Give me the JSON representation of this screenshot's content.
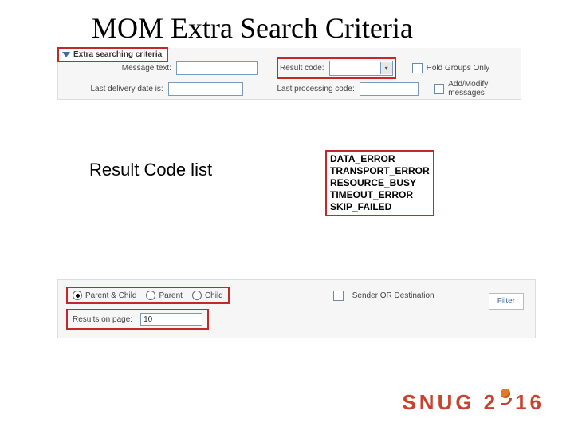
{
  "title": "MOM Extra Search Criteria",
  "panel": {
    "header": "Extra searching criteria",
    "message_text_label": "Message text:",
    "result_code_label": "Result code:",
    "hold_groups_label": "Hold Groups Only",
    "last_delivery_label": "Last delivery date is:",
    "last_processing_label": "Last processing code:",
    "add_modify_label": "Add/Modify messages"
  },
  "callout": {
    "label": "Result Code list",
    "items": [
      "DATA_ERROR",
      "TRANSPORT_ERROR",
      "RESOURCE_BUSY",
      "TIMEOUT_ERROR",
      "SKIP_FAILED"
    ]
  },
  "bottom": {
    "radios": {
      "parent_child": "Parent & Child",
      "parent": "Parent",
      "child": "Child"
    },
    "sender_or_dest": "Sender OR Destination",
    "results_on_page_label": "Results on page:",
    "results_on_page_value": "10",
    "filter_label": "Filter"
  },
  "logo": {
    "s": "S",
    "n": "N",
    "u": "U",
    "g": "G",
    "two": "2",
    "one": "1",
    "six": "6"
  }
}
